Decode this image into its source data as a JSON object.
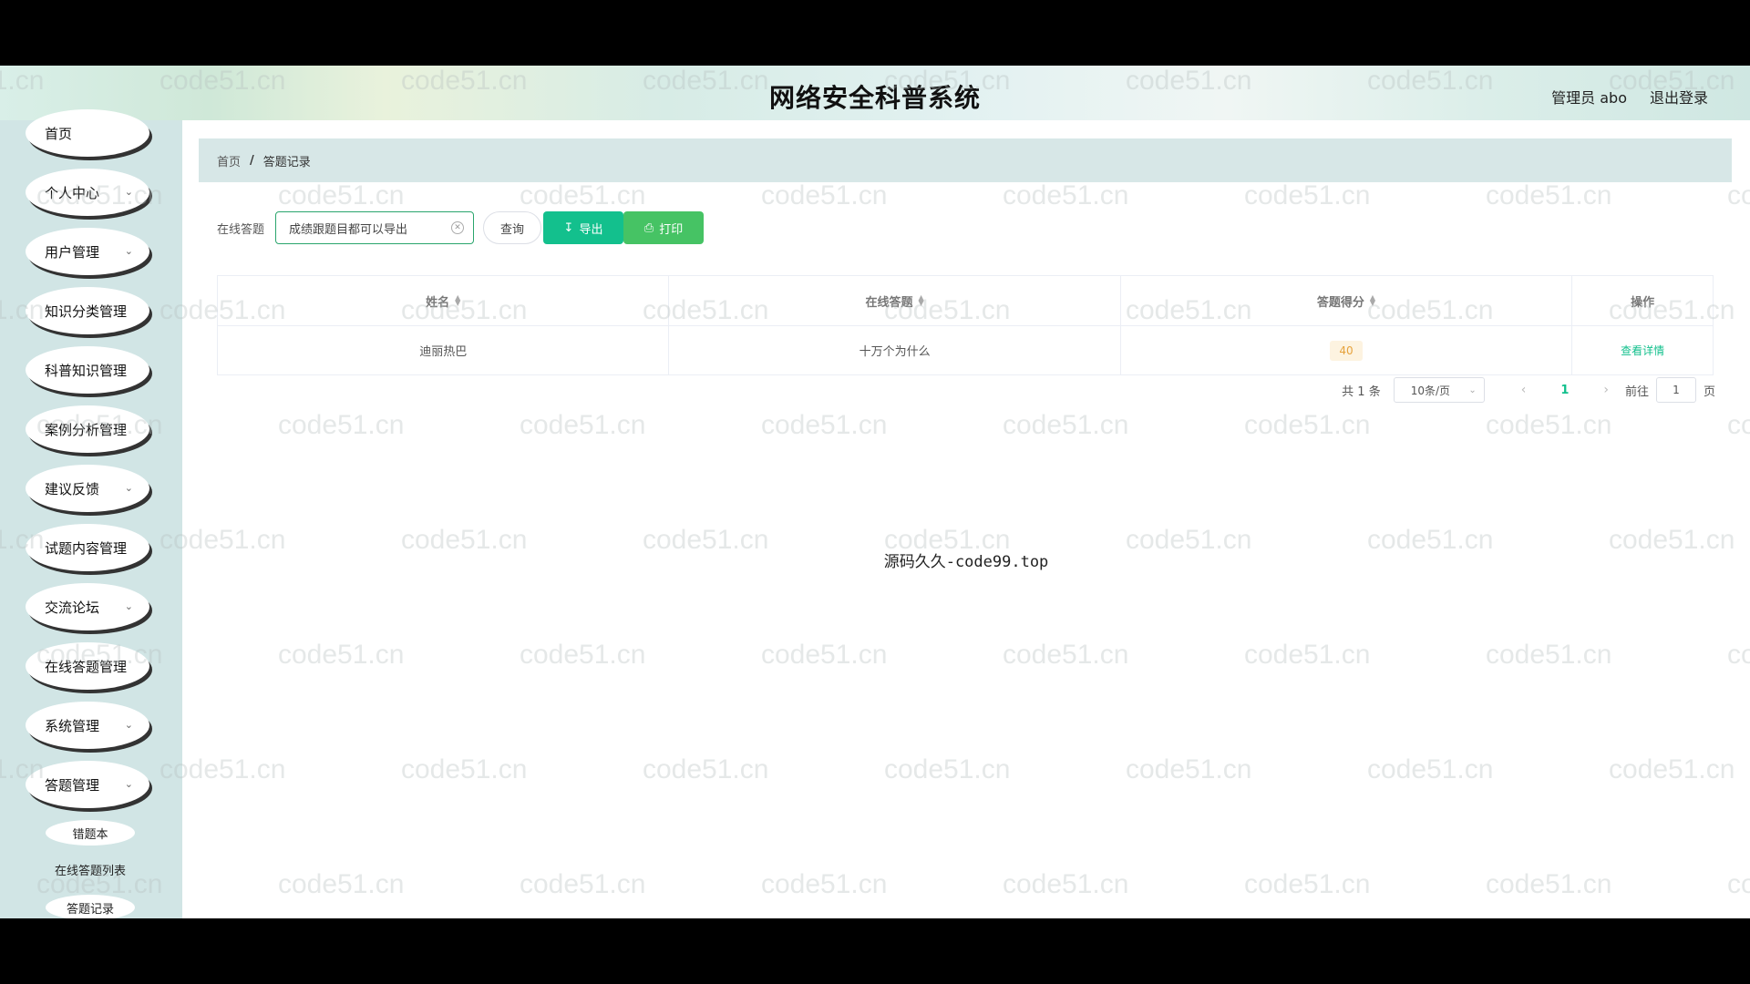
{
  "header": {
    "title": "网络安全科普系统",
    "user": "管理员 abo",
    "logout": "退出登录"
  },
  "sidebar": {
    "items": [
      {
        "label": "首页",
        "has_chevron": false
      },
      {
        "label": "个人中心",
        "has_chevron": true
      },
      {
        "label": "用户管理",
        "has_chevron": true
      },
      {
        "label": "知识分类管理",
        "has_chevron": false
      },
      {
        "label": "科普知识管理",
        "has_chevron": false
      },
      {
        "label": "案例分析管理",
        "has_chevron": false
      },
      {
        "label": "建议反馈",
        "has_chevron": true
      },
      {
        "label": "试题内容管理",
        "has_chevron": false
      },
      {
        "label": "交流论坛",
        "has_chevron": true
      },
      {
        "label": "在线答题管理",
        "has_chevron": false
      },
      {
        "label": "系统管理",
        "has_chevron": true
      },
      {
        "label": "答题管理",
        "has_chevron": true
      }
    ],
    "sub_items": [
      "错题本",
      "在线答题列表",
      "答题记录"
    ]
  },
  "breadcrumb": {
    "home": "首页",
    "separator": "/",
    "current": "答题记录"
  },
  "search": {
    "label": "在线答题",
    "value": "成绩跟题目都可以导出",
    "query_label": "查询",
    "export_label": "导出",
    "print_label": "打印"
  },
  "table": {
    "headers": [
      "姓名",
      "在线答题",
      "答题得分",
      "操作"
    ],
    "rows": [
      {
        "name": "迪丽热巴",
        "exam": "十万个为什么",
        "score": "40",
        "action": "查看详情"
      }
    ]
  },
  "pagination": {
    "total": "共 1 条",
    "page_size": "10条/页",
    "current_page": "1",
    "goto_prefix": "前往",
    "goto_value": "1",
    "goto_suffix": "页"
  },
  "centre_text": "源码久久-code99.top",
  "watermark_text": "code51.cn",
  "colors": {
    "accent": "#13c08d",
    "print": "#46c364",
    "sidebar_bg": "#d1e5e5",
    "breadcrumb_bg": "#d7e7e7"
  }
}
